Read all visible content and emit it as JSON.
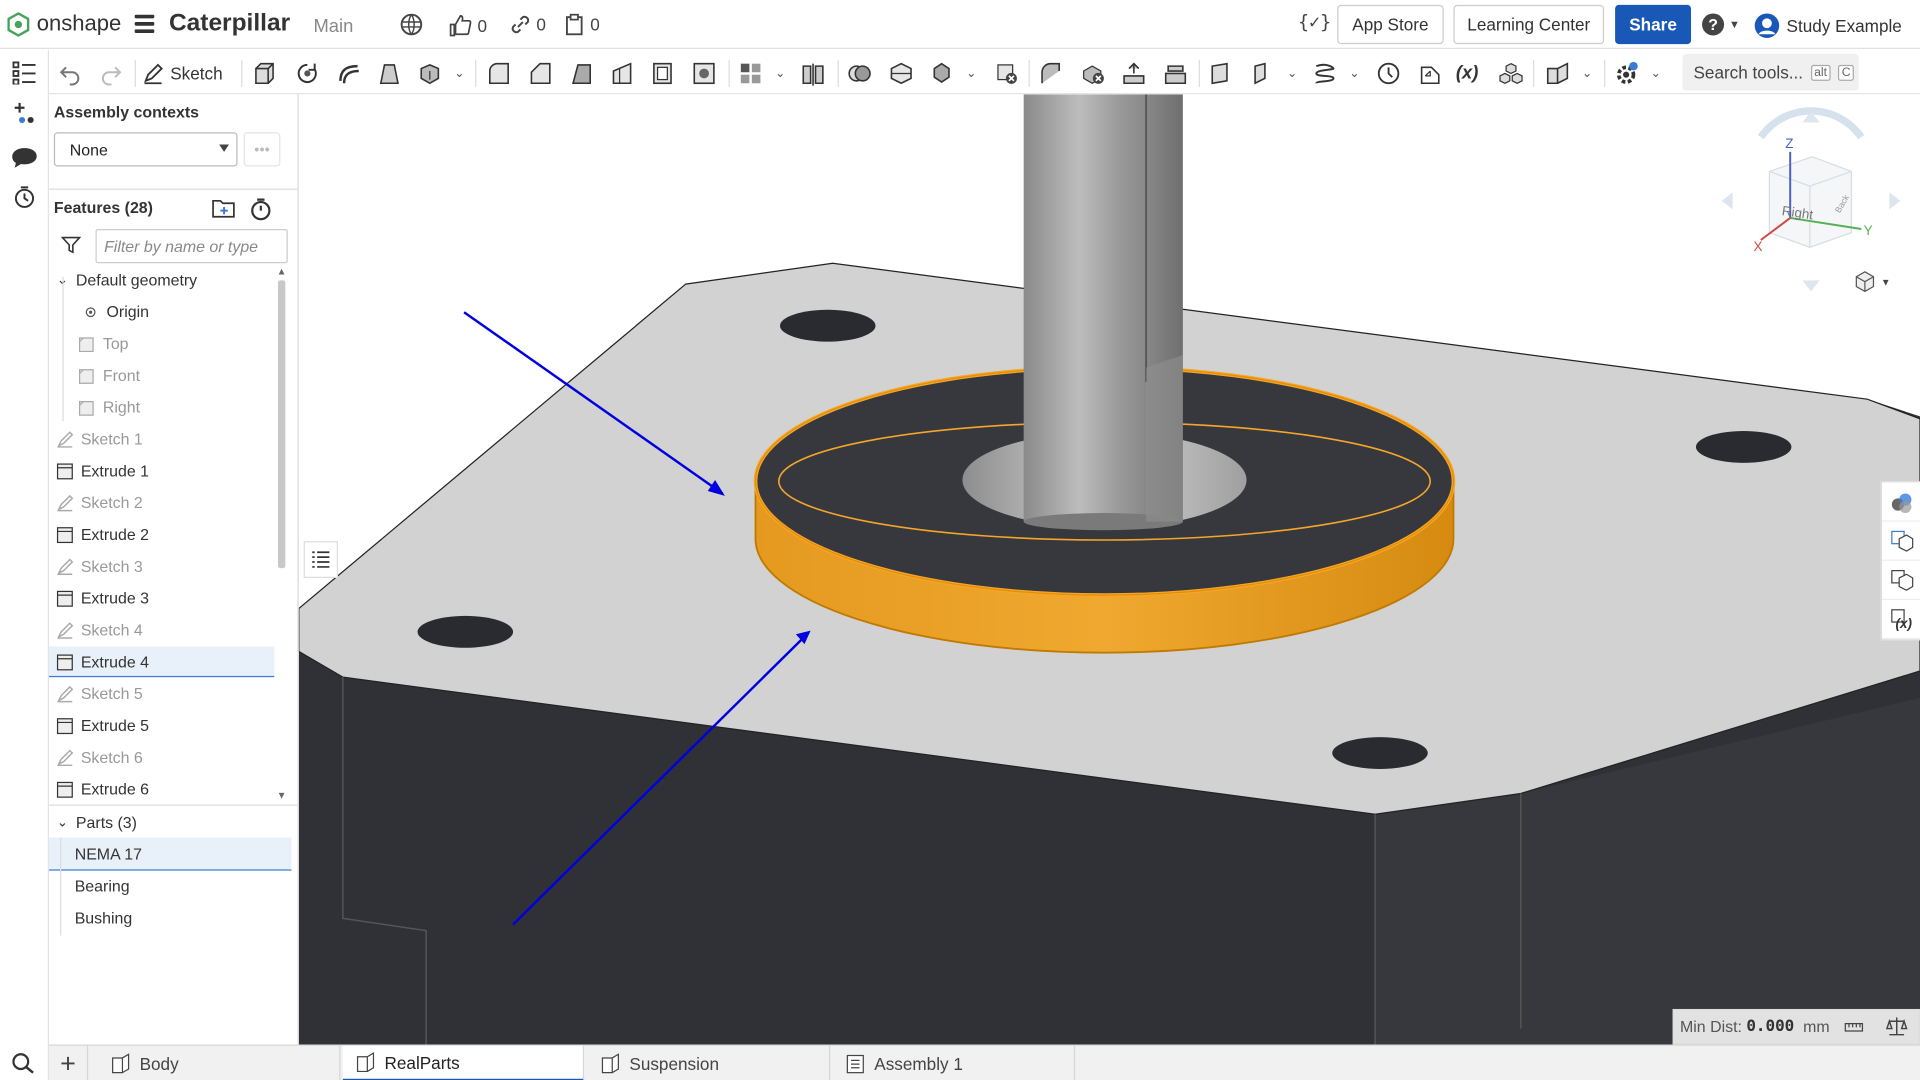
{
  "topbar": {
    "brand": "onshape",
    "doc_name": "Caterpillar",
    "branch": "Main",
    "likes": "0",
    "links": "0",
    "versions": "0",
    "app_store": "App Store",
    "learning_center": "Learning Center",
    "share": "Share",
    "user": "Study Example"
  },
  "toolbar": {
    "sketch": "Sketch",
    "search_tools": "Search tools...",
    "kbd_alt": "alt",
    "kbd_c": "C"
  },
  "panel": {
    "assembly_contexts": "Assembly contexts",
    "context_value": "None",
    "features_title": "Features (28)",
    "filter_placeholder": "Filter by name or type",
    "features": [
      {
        "label": "Default geometry",
        "type": "group"
      },
      {
        "label": "Origin",
        "type": "origin"
      },
      {
        "label": "Top",
        "type": "plane"
      },
      {
        "label": "Front",
        "type": "plane"
      },
      {
        "label": "Right",
        "type": "plane"
      },
      {
        "label": "Sketch 1",
        "type": "sketch"
      },
      {
        "label": "Extrude 1",
        "type": "extrude"
      },
      {
        "label": "Sketch 2",
        "type": "sketch"
      },
      {
        "label": "Extrude 2",
        "type": "extrude"
      },
      {
        "label": "Sketch 3",
        "type": "sketch"
      },
      {
        "label": "Extrude 3",
        "type": "extrude"
      },
      {
        "label": "Sketch 4",
        "type": "sketch"
      },
      {
        "label": "Extrude 4",
        "type": "extrude",
        "highlighted": true
      },
      {
        "label": "Sketch 5",
        "type": "sketch"
      },
      {
        "label": "Extrude 5",
        "type": "extrude"
      },
      {
        "label": "Sketch 6",
        "type": "sketch"
      },
      {
        "label": "Extrude 6",
        "type": "extrude"
      }
    ],
    "parts_title": "Parts (3)",
    "parts": [
      {
        "label": "NEMA 17",
        "selected": true
      },
      {
        "label": "Bearing"
      },
      {
        "label": "Bushing"
      }
    ]
  },
  "tabs": [
    {
      "label": "Body",
      "type": "partstudio"
    },
    {
      "label": "RealParts",
      "type": "partstudio",
      "active": true
    },
    {
      "label": "Suspension",
      "type": "partstudio"
    },
    {
      "label": "Assembly 1",
      "type": "assembly"
    }
  ],
  "viewport": {
    "min_dist_label": "Min Dist:",
    "min_dist_value": "0.000",
    "min_dist_unit": "mm",
    "view_cube_face": "Right",
    "view_cube_side": "Back",
    "axis_x": "X",
    "axis_y": "Y",
    "axis_z": "Z"
  },
  "colors": {
    "accent": "#1a58b8",
    "selection": "#e9a024",
    "annotation_arrow": "#0000e0",
    "model_top": "#d2d2d2",
    "model_side": "#2e3035"
  }
}
